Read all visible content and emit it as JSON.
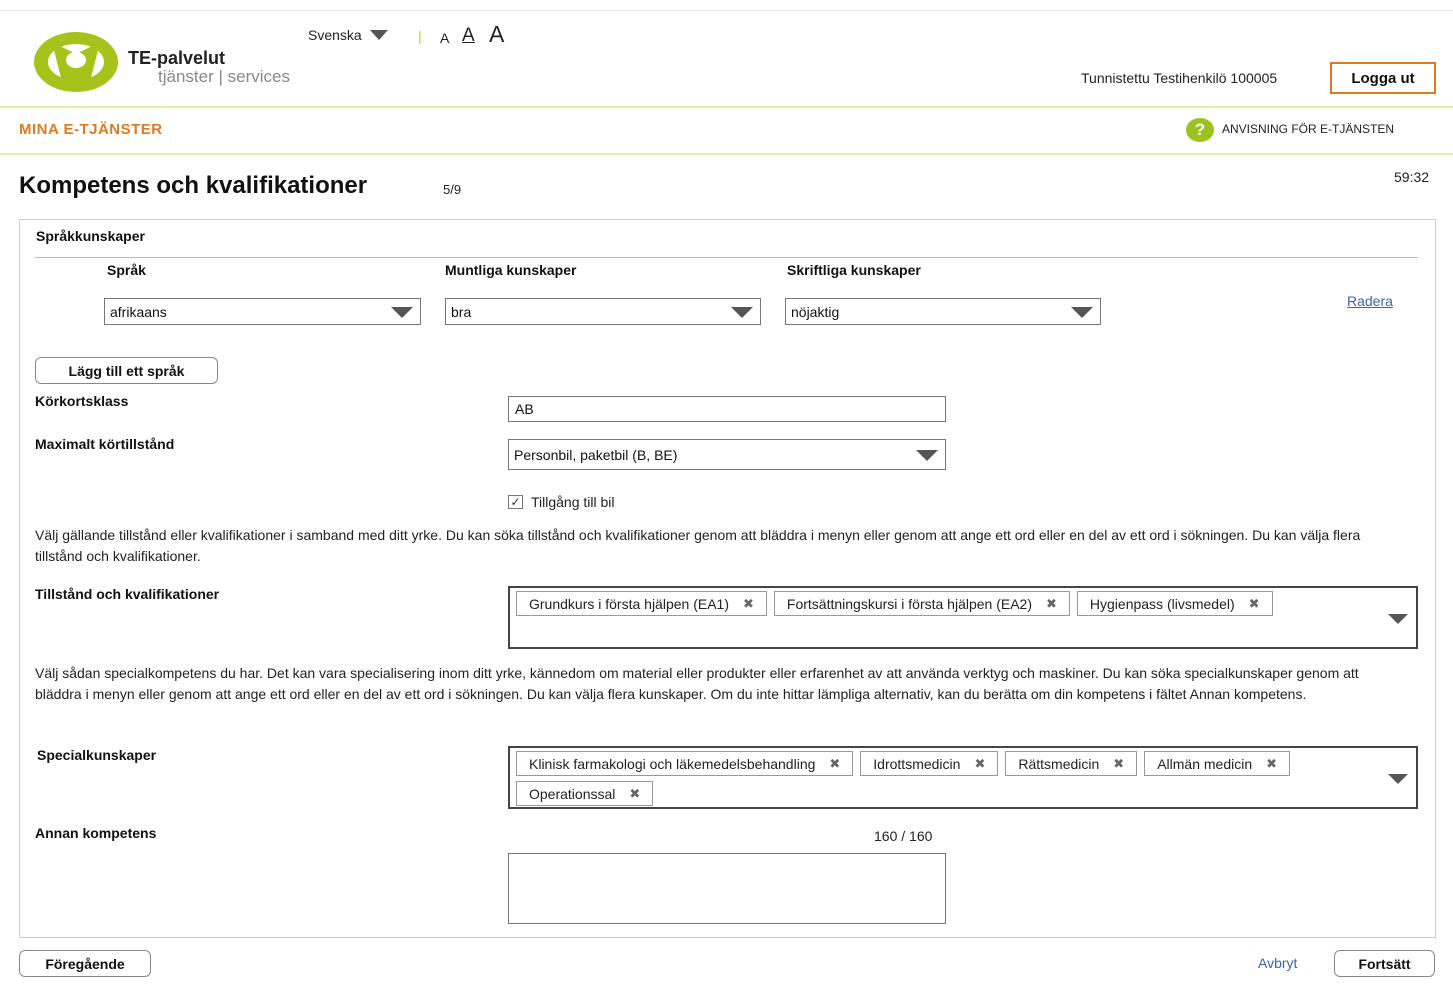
{
  "header": {
    "brand_name": "TE-palvelut",
    "brand_sub": "tjänster | services",
    "language": "Svenska",
    "separator": "|",
    "font_sizes": [
      "A",
      "A",
      "A"
    ],
    "authenticated_user": "Tunnistettu Testihenkilö 100005",
    "logout_label": "Logga ut"
  },
  "nav": {
    "mine": "MINA E-TJÄNSTER",
    "help_icon": "?",
    "help": "ANVISNING FÖR E-TJÄNSTEN"
  },
  "page": {
    "title": "Kompetens och kvalifikationer",
    "step": "5/9",
    "timer": "59:32"
  },
  "languages": {
    "section_title": "Språkkunskaper",
    "col_language": "Språk",
    "col_oral": "Muntliga kunskaper",
    "col_written": "Skriftliga kunskaper",
    "row": {
      "language": "afrikaans",
      "oral": "bra",
      "written": "nöjaktig",
      "delete": "Radera"
    },
    "add_button": "Lägg till ett språk"
  },
  "license": {
    "label": "Körkortsklass",
    "value": "AB",
    "max_label": "Maximalt körtillstånd",
    "max_value": "Personbil, paketbil (B, BE)",
    "car_access_checked": true,
    "car_access_mark": "✓",
    "car_access": "Tillgång till bil"
  },
  "permits": {
    "help": "Välj gällande tillstånd eller kvalifikationer i samband med ditt yrke. Du kan söka tillstånd och kvalifikationer genom att bläddra i menyn eller genom att ange ett ord eller en del av ett ord i sökningen. Du kan välja flera tillstånd och kvalifikationer.",
    "label": "Tillstånd och kvalifikationer",
    "tags": [
      "Grundkurs i första hjälpen (EA1)",
      "Fortsättningskursi i första hjälpen (EA2)",
      "Hygienpass (livsmedel)"
    ]
  },
  "special": {
    "help": "Välj sådan specialkompetens du har. Det kan vara specialisering inom ditt yrke, kännedom om material eller produkter eller erfarenhet av att använda verktyg och maskiner. Du kan söka specialkunskaper genom att bläddra i menyn eller genom att ange ett ord eller en del av ett ord i sökningen. Du kan välja flera kunskaper. Om du inte hittar lämpliga alternativ, kan du berätta om din kompetens i fältet Annan kompetens.",
    "label": "Specialkunskaper",
    "tags": [
      "Klinisk farmakologi och läkemedelsbehandling",
      "Idrottsmedicin",
      "Rättsmedicin",
      "Allmän medicin",
      "Operationssal"
    ]
  },
  "other": {
    "label": "Annan kompetens",
    "counter": "160 / 160",
    "value": ""
  },
  "footer": {
    "prev": "Föregående",
    "cancel": "Avbryt",
    "next": "Fortsätt"
  },
  "tag_remove": "✖",
  "colors": {
    "accent_orange": "#e07a1f",
    "brand_green": "#9cc21d",
    "divider_green": "#e6ebb0",
    "link_blue": "#3a64b3"
  }
}
